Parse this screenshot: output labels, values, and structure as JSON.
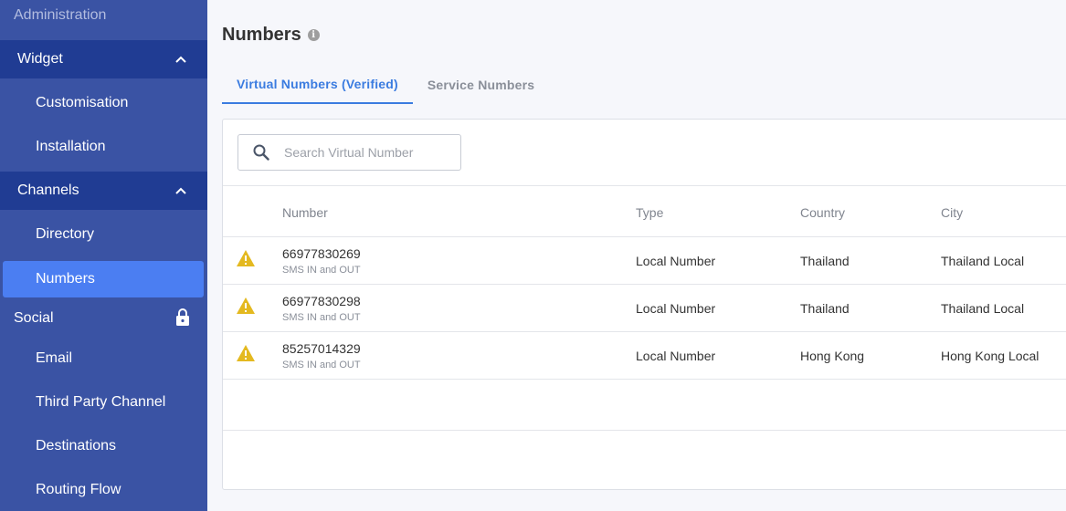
{
  "sidebar": {
    "heading": "Administration",
    "widget": {
      "label": "Widget",
      "items": [
        "Customisation",
        "Installation"
      ]
    },
    "channels": {
      "label": "Channels",
      "items": [
        "Directory",
        "Numbers"
      ]
    },
    "social": {
      "label": "Social",
      "items": [
        "Email",
        "Third Party Channel",
        "Destinations",
        "Routing Flow"
      ]
    },
    "active_item": "Numbers"
  },
  "page": {
    "title": "Numbers"
  },
  "tabs": [
    {
      "label": "Virtual Numbers (Verified)",
      "active": true
    },
    {
      "label": "Service Numbers",
      "active": false
    }
  ],
  "search": {
    "placeholder": "Search Virtual Number",
    "value": ""
  },
  "table": {
    "columns": [
      "Number",
      "Type",
      "Country",
      "City"
    ],
    "rows": [
      {
        "number": "66977830269",
        "sub": "SMS IN and OUT",
        "type": "Local Number",
        "country": "Thailand",
        "city": "Thailand Local",
        "status_icon": "warning-icon"
      },
      {
        "number": "66977830298",
        "sub": "SMS IN and OUT",
        "type": "Local Number",
        "country": "Thailand",
        "city": "Thailand Local",
        "status_icon": "warning-icon"
      },
      {
        "number": "85257014329",
        "sub": "SMS IN and OUT",
        "type": "Local Number",
        "country": "Hong Kong",
        "city": "Hong Kong Local",
        "status_icon": "warning-icon"
      }
    ]
  },
  "colors": {
    "sidebar_bg": "#3a53a4",
    "section_bg": "#203c93",
    "active_item_bg": "#4b7ef2",
    "accent": "#3b7ce0",
    "warning": "#e4b920"
  }
}
